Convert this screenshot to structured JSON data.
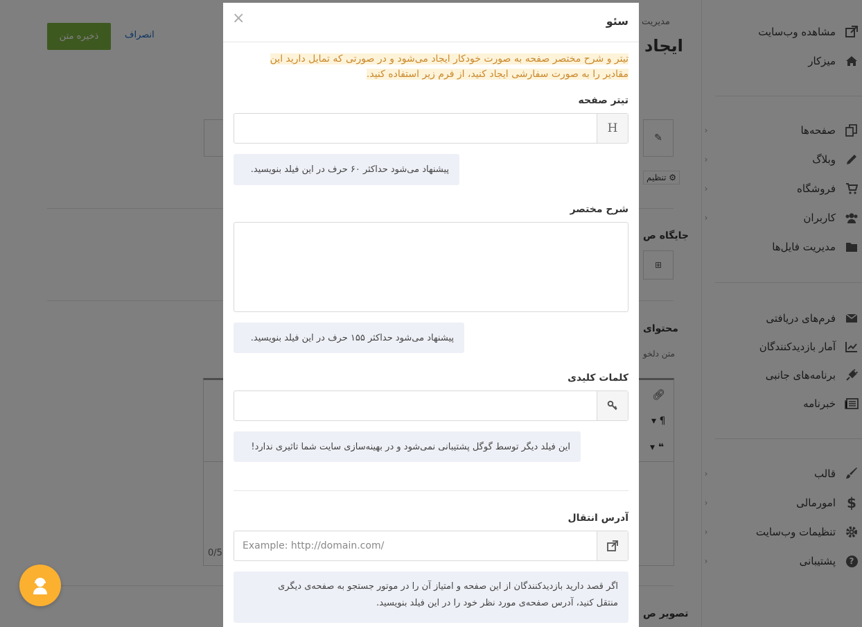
{
  "sidebar": {
    "view_site": {
      "label": "مشاهده وب‌سایت",
      "icon": "external-link-icon"
    },
    "dashboard": {
      "label": "میزکار",
      "icon": "home-icon"
    },
    "pages": {
      "label": "صفحه‌ها",
      "icon": "copy-icon"
    },
    "blog": {
      "label": "وبلاگ",
      "icon": "pencil-icon"
    },
    "shop": {
      "label": "فروشگاه",
      "icon": "cart-icon"
    },
    "users": {
      "label": "کاربران",
      "icon": "users-icon"
    },
    "files": {
      "label": "مدیریت فایل‌ها",
      "icon": "folder-icon"
    },
    "forms": {
      "label": "فرم‌های دریافتی",
      "icon": "envelope-icon"
    },
    "stats": {
      "label": "آمار بازدیدکنندگان",
      "icon": "chart-icon"
    },
    "plugins": {
      "label": "برنامه‌های جانبی",
      "icon": "plug-icon"
    },
    "newsletter": {
      "label": "خبرنامه",
      "icon": "newspaper-icon"
    },
    "theme": {
      "label": "قالب",
      "icon": "brush-icon"
    },
    "finance": {
      "label": "امورمالی",
      "icon": "dollar-icon"
    },
    "site_settings": {
      "label": "تنظیمات وب‌سایت",
      "icon": "gear-icon"
    },
    "support": {
      "label": "پشتیبانی",
      "icon": "question-icon"
    }
  },
  "main": {
    "save_label": "ذخیره متن",
    "cancel_label": "انصراف",
    "breadcrumb": "مدیریت",
    "page_title": "ایجاد",
    "settings_chip": "تنظیم",
    "position_label": "جایگاه ص",
    "content_label": "محتوای",
    "content_sub": "متن دلخو",
    "counter": "0/5",
    "image_label": "تصویر ص"
  },
  "modal": {
    "title": "سئو",
    "close": "×",
    "intro": "تیتر و شرح مختصر صفحه به صورت خودکار ایجاد می‌شود و در صورتی که تمایل دارید این مقادیر را به صورت سفارشی ایجاد کنید، از فرم زیر استفاده کنید.",
    "page_title_label": "تیتر صفحه",
    "page_title_addon": "H",
    "page_title_hint": "پیشنهاد می‌شود حداکثر ۶۰ حرف در این فیلد بنویسید.",
    "description_label": "شرح مختصر",
    "description_hint": "پیشنهاد می‌شود حداکثر ۱۵۵ حرف در این فیلد بنویسید.",
    "keywords_label": "کلمات کلیدی",
    "keywords_hint": "این فیلد دیگر توسط گوگل پشتیبانی نمی‌شود و در بهینه‌سازی سایت شما تاثیری ندارد!",
    "redirect_label": "آدرس انتقال",
    "redirect_placeholder": "Example: http://domain.com/",
    "redirect_hint_line1": "اگر قصد دارید بازدیدکنندگان از این صفحه و امتیاز آن را در موتور جستجو به صفحه‌ی دیگری",
    "redirect_hint_line2": "منتقل کنید، آدرس صفحه‌ی مورد نظر خود را در این فیلد بنویسید."
  },
  "colors": {
    "save_button": "#7cb341",
    "intro_text": "#c9882c",
    "intro_highlight": "#fdf3d9",
    "hint_bg": "#eef0f7",
    "support_bubble": "#fbb030"
  }
}
